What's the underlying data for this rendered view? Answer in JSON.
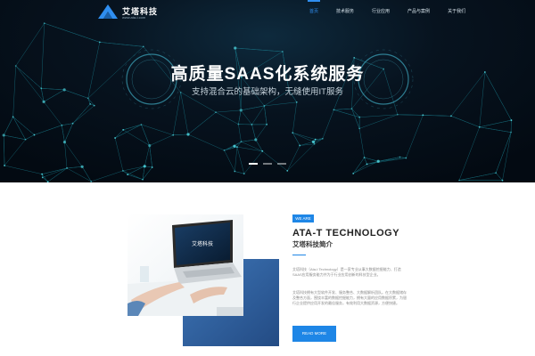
{
  "brand": {
    "name": "艾塔科技",
    "url": "www.ata-t.com"
  },
  "nav": {
    "items": [
      {
        "label": "首页"
      },
      {
        "label": "技术服务"
      },
      {
        "label": "行业应用"
      },
      {
        "label": "产品与案例"
      },
      {
        "label": "关于我们"
      }
    ],
    "active_index": 0
  },
  "hero": {
    "title": "高质量SAAS化系统服务",
    "subtitle": "支持混合云的基础架构，无缝使用IT服务",
    "slide_count": 3,
    "active_slide": 0
  },
  "about": {
    "badge": "WE ARE",
    "title": "ATA-T TECHNOLOGY",
    "subtitle": "艾塔科技简介",
    "paragraph1": "艾塔科技（Ata-t Technology）是一家专业从事大数据挖掘能力、打造SAAS应用服务能力并为于行业应用创新的科技型企业。",
    "paragraph2": "艾塔科技拥有大型软件开发、服务整合、大数据解析团队。在大数据储存及整合方面，围绕丰富的数据挖掘能力，拥有大量的应用数据积累，为银行企业提供应用开发的最佳服务，有效利用大数据资源，方便快捷。",
    "button_label": "READ MORE",
    "laptop_screen_text": "艾塔科技"
  },
  "colors": {
    "accent": "#1e86e6",
    "hero_bg": "#050d16",
    "hero_glow": "#2bbfc8"
  },
  "icons": {
    "logo": "triangle-logo-icon"
  }
}
